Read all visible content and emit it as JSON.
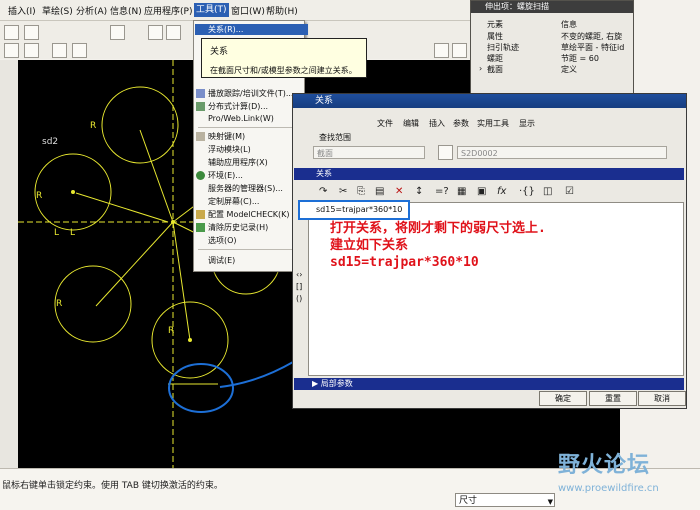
{
  "menubar": {
    "items": [
      "插入(I)",
      "草绘(S)",
      "分析(A)",
      "信息(N)",
      "应用程序(P)",
      "工具(T)",
      "窗口(W)",
      "帮助(H)"
    ],
    "active_index": 5
  },
  "tools_menu": {
    "items": [
      {
        "label": "关系(R)...",
        "highlighted": true
      },
      {
        "label": "播放跟踪/培训文件(T)..."
      },
      {
        "label": "分布式计算(D)..."
      },
      {
        "label": "Pro/Web.Link(W)"
      },
      {
        "label": "映射键(M)"
      },
      {
        "label": "浮动模块(L)"
      },
      {
        "label": "辅助应用程序(X)"
      },
      {
        "label": "环境(E)..."
      },
      {
        "label": "服务器的管理器(S)..."
      },
      {
        "label": "定制屏幕(C)..."
      },
      {
        "label": "配置 ModelCHECK(K)"
      },
      {
        "label": "清除历史记录(H)"
      },
      {
        "label": "选项(O)"
      },
      {
        "label": "调试(E)"
      }
    ]
  },
  "tooltip": {
    "title": "关系",
    "description": "在截面尺寸和/或模型参数之间建立关系。"
  },
  "feature_panel": {
    "title": "伸出项：螺旋扫描",
    "header": [
      "元素",
      "信息"
    ],
    "rows": [
      [
        "属性",
        "不变的螺距, 右旋"
      ],
      [
        "扫引轨迹",
        "草绘平面 - 特征id"
      ],
      [
        "螺距",
        "节距 = 60"
      ],
      [
        "截面",
        "定义"
      ]
    ]
  },
  "dialog": {
    "title": "关系",
    "menu": [
      "文件",
      "编辑",
      "插入",
      "参数",
      "实用工具",
      "显示"
    ],
    "lookin_label": "查找范围",
    "lookin_value": "截面",
    "model_value": "S2D0002",
    "section_header": "关系",
    "relation": "sd15=trajpar*360*10",
    "local_params_label": "局部参数",
    "buttons": {
      "ok": "确定",
      "reset": "重置",
      "cancel": "取消"
    }
  },
  "canvas": {
    "labels": {
      "sd2": "sd2",
      "r": "R",
      "l": "L"
    }
  },
  "annotation": {
    "line1": "打开关系，将刚才剩下的弱尺寸选上.",
    "line2": "建立如下关系",
    "line3": "sd15=trajpar*360*10"
  },
  "status": {
    "message": "鼠标右键单击锁定约束。使用 TAB 键切换激活的约束。",
    "filter": "尺寸"
  },
  "watermark": {
    "text": "野火论坛",
    "url": "www.proewildfire.cn"
  },
  "colors": {
    "sketch": "#e8e830",
    "highlight": "#2b5fb3",
    "annotation": "#e0121a",
    "callout": "#1d6fd6"
  }
}
